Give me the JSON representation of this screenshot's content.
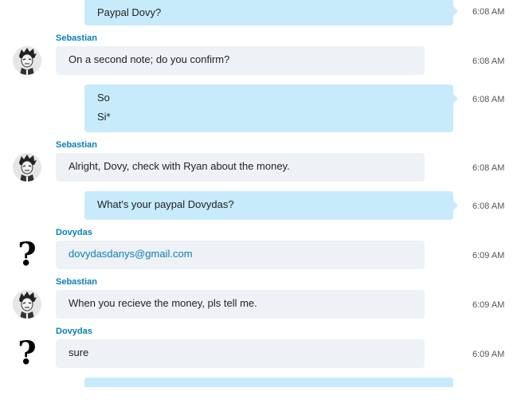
{
  "messages": {
    "m1": {
      "text": "Paypal Dovy?",
      "time": "6:08 AM"
    },
    "m2": {
      "sender": "Sebastian",
      "text": "On a second note; do you confirm?",
      "time": "6:08 AM"
    },
    "m3": {
      "lines": [
        "So",
        "Si*"
      ],
      "time": "6:08 AM"
    },
    "m4": {
      "sender": "Sebastian",
      "text": "Alright, Dovy, check with Ryan about the money.",
      "time": "6:08 AM"
    },
    "m5": {
      "text": "What's your paypal Dovydas?",
      "time": "6:08 AM"
    },
    "m6": {
      "sender": "Dovydas",
      "text": "dovydasdanys@gmail.com",
      "time": "6:09 AM"
    },
    "m7": {
      "sender": "Sebastian",
      "text": "When you recieve the money, pls tell me.",
      "time": "6:09 AM"
    },
    "m8": {
      "sender": "Dovydas",
      "text": "sure",
      "time": "6:09 AM"
    }
  },
  "avatars": {
    "sebastian_icon": "cartoon-man-avatar",
    "dovydas_icon": "question-mark-avatar",
    "dovydas_glyph": "?"
  },
  "colors": {
    "outgoing_bubble": "#c7ebfb",
    "incoming_bubble": "#eef1f5",
    "sender_name": "#0a7fb5",
    "link": "#0a7fb5"
  }
}
